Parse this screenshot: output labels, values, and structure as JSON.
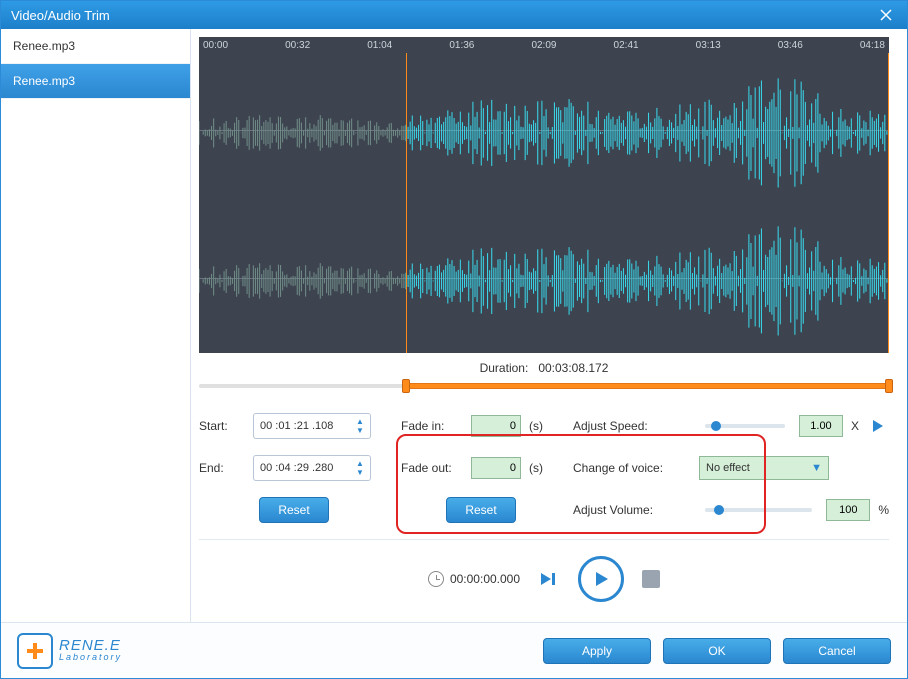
{
  "window": {
    "title": "Video/Audio Trim"
  },
  "sidebar": {
    "files": [
      "Renee.mp3",
      "Renee.mp3"
    ],
    "selectedIndex": 1
  },
  "timeline": {
    "ticks": [
      "00:00",
      "00:32",
      "01:04",
      "01:36",
      "02:09",
      "02:41",
      "03:13",
      "03:46",
      "04:18"
    ],
    "trim_start_pct": 30,
    "trim_end_pct": 100
  },
  "duration": {
    "label": "Duration:",
    "value": "00:03:08.172"
  },
  "trim": {
    "start_label": "Start:",
    "start_value": "00 :01 :21 .108",
    "end_label": "End:",
    "end_value": "00 :04 :29 .280",
    "reset_label": "Reset"
  },
  "fade": {
    "in_label": "Fade in:",
    "in_value": "0",
    "unit": "(s)",
    "out_label": "Fade out:",
    "out_value": "0",
    "reset_label": "Reset"
  },
  "adjust": {
    "speed_label": "Adjust Speed:",
    "speed_value": "1.00",
    "speed_unit": "X",
    "voice_label": "Change of voice:",
    "voice_value": "No effect",
    "volume_label": "Adjust Volume:",
    "volume_value": "100",
    "volume_unit": "%"
  },
  "playback": {
    "clock": "00:00:00.000"
  },
  "footer": {
    "brand": "RENE.E",
    "brand_sub": "Laboratory",
    "apply": "Apply",
    "ok": "OK",
    "cancel": "Cancel"
  }
}
